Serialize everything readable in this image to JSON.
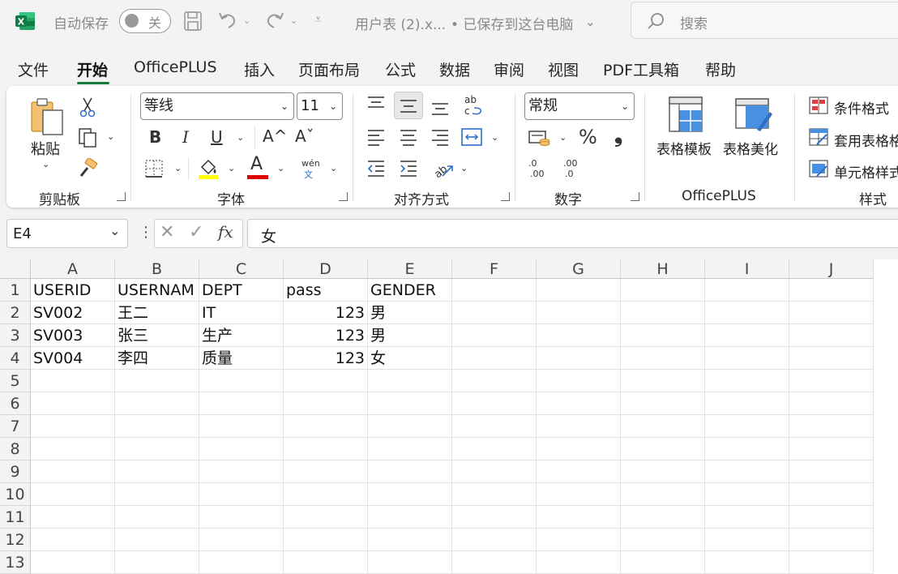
{
  "titlebar": {
    "autosave_label": "自动保存",
    "autosave_state": "关",
    "doc_title": "用户表 (2).x...",
    "save_status": "• 已保存到这台电脑",
    "search_placeholder": "搜索"
  },
  "tabs": [
    "文件",
    "开始",
    "OfficePLUS",
    "插入",
    "页面布局",
    "公式",
    "数据",
    "审阅",
    "视图",
    "PDF工具箱",
    "帮助"
  ],
  "ribbon": {
    "clipboard": {
      "paste_label": "粘贴",
      "group_label": "剪贴板"
    },
    "font": {
      "font_name": "等线",
      "font_size": "11",
      "group_label": "字体",
      "bold": "B",
      "italic": "I",
      "underline": "U",
      "grow": "A^",
      "shrink": "Aˇ",
      "font_color_glyph": "A",
      "pinyin_top": "wén",
      "pinyin_bottom": "文"
    },
    "alignment": {
      "group_label": "对齐方式"
    },
    "number": {
      "format": "常规",
      "group_label": "数字",
      "percent": "%",
      "comma": "❟",
      "inc_dec_top": ".00",
      "inc_dec_bottom": ".0"
    },
    "officeplus": {
      "table_template": "表格模板",
      "table_beautify": "表格美化",
      "group_label": "OfficePLUS"
    },
    "styles": {
      "conditional": "条件格式",
      "as_table": "套用表格格",
      "cell_styles": "单元格样式",
      "group_label": "样式"
    }
  },
  "formula_bar": {
    "cell_ref": "E4",
    "fx": "fx",
    "content": "女"
  },
  "grid": {
    "columns": [
      "A",
      "B",
      "C",
      "D",
      "E",
      "F",
      "G",
      "H",
      "I",
      "J"
    ],
    "row_numbers": [
      "1",
      "2",
      "3",
      "4",
      "5",
      "6",
      "7",
      "8",
      "9",
      "10",
      "11",
      "12",
      "13"
    ],
    "rows": [
      [
        "USERID",
        "USERNAM",
        "DEPT",
        "pass",
        "GENDER"
      ],
      [
        "SV002",
        "王二",
        "IT",
        "123",
        "男"
      ],
      [
        "SV003",
        "张三",
        "生产",
        "123",
        "男"
      ],
      [
        "SV004",
        "李四",
        "质量",
        "123",
        "女"
      ]
    ]
  },
  "colors": {
    "excel_green": "#107c41",
    "highlight_yellow": "#ffff00",
    "font_red": "#e00000"
  }
}
